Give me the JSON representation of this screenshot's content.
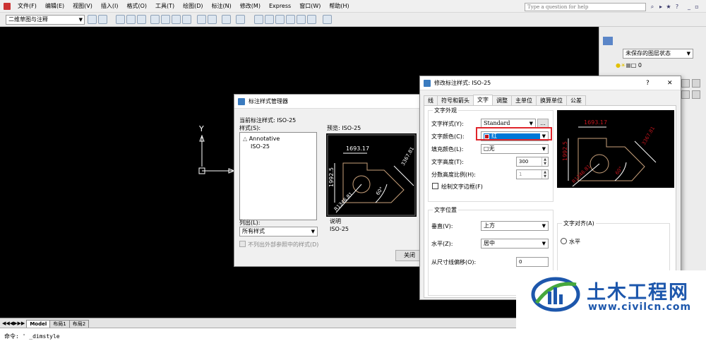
{
  "menu": {
    "items": [
      "文件(F)",
      "编辑(E)",
      "视图(V)",
      "插入(I)",
      "格式(O)",
      "工具(T)",
      "绘图(D)",
      "标注(N)",
      "修改(M)",
      "Express",
      "窗口(W)",
      "帮助(H)"
    ],
    "help_placeholder": "Type a question for help"
  },
  "toolbar": {
    "workspace": "二维草图与注释"
  },
  "right_panel": {
    "layer_state": "未保存的图层状态",
    "layer_value": "0"
  },
  "canvas": {
    "ucs_y": "Y"
  },
  "layout_tabs": [
    "Model",
    "布局1",
    "布局2"
  ],
  "command": {
    "prompt": "命令: ' _dimstyle"
  },
  "dim_manager": {
    "title": "标注样式管理器",
    "current_label": "当前标注样式:",
    "current_value": "ISO-25",
    "styles_label": "样式(S):",
    "styles": [
      "Annotative",
      "ISO-25"
    ],
    "preview_label": "预览:",
    "preview_value": "ISO-25",
    "list_label": "列出(L):",
    "list_value": "所有样式",
    "exclude_xref": "不列出外部参照中的样式(D)",
    "desc_label": "说明",
    "desc_value": "ISO-25",
    "close_button": "关闭"
  },
  "preview_dims": {
    "top": "1693.17",
    "left": "1992.5",
    "side": "3367.81",
    "angle": "60°",
    "radius": "R1346.81"
  },
  "modify": {
    "title": "修改标注样式: ISO-25",
    "help": "?",
    "close": "✕",
    "tabs": [
      "线",
      "符号和箭头",
      "文字",
      "调整",
      "主单位",
      "换算单位",
      "公差"
    ],
    "active_tab": 2,
    "appearance": {
      "group": "文字外观",
      "style_label": "文字样式(Y):",
      "style_value": "Standard",
      "ellipsis": "...",
      "color_label": "文字颜色(C):",
      "color_value": "红",
      "color_swatch": "#c0141c",
      "fill_label": "填充颜色(L):",
      "fill_value": "无",
      "height_label": "文字高度(T):",
      "height_value": "300",
      "fraction_label": "分数高度比例(H):",
      "fraction_value": "1",
      "frame_label": "绘制文字边框(F)"
    },
    "placement": {
      "group": "文字位置",
      "vertical_label": "垂直(V):",
      "vertical_value": "上方",
      "horizontal_label": "水平(Z):",
      "horizontal_value": "居中",
      "offset_label": "从尺寸线偏移(O):",
      "offset_value": "0"
    },
    "alignment": {
      "group": "文字对齐(A)",
      "horizontal": "水平"
    }
  },
  "watermark": {
    "title": "土木工程网",
    "url": "www.civilcn.com"
  },
  "colors": {
    "accent_red": "#e0252b",
    "selection_blue": "#0078d7",
    "dim_line": "#ffffff",
    "preview_bg": "#000000"
  }
}
